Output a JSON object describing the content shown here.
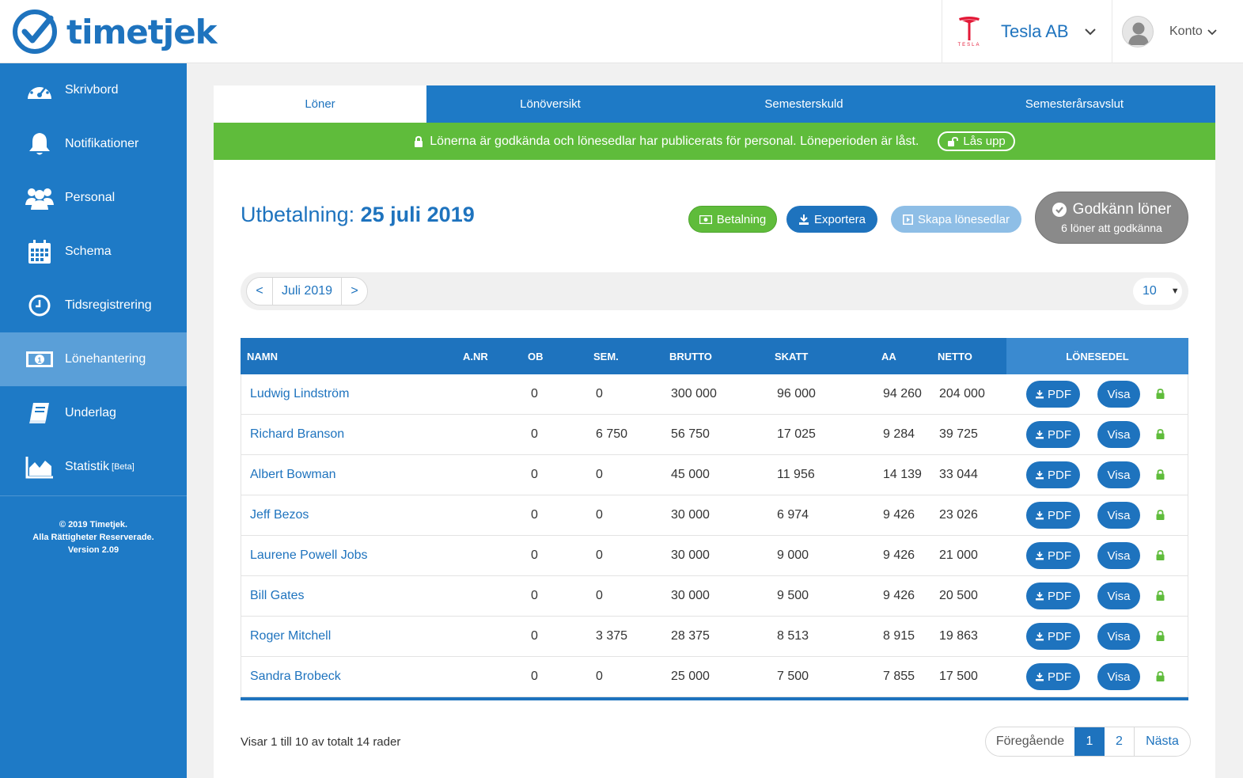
{
  "header": {
    "logo_text": "timetjek",
    "company_logo_label": "TESLA",
    "company_name": "Tesla AB",
    "account_label": "Konto"
  },
  "sidebar": {
    "items": [
      {
        "label": "Skrivbord",
        "icon": "dashboard-icon"
      },
      {
        "label": "Notifikationer",
        "icon": "bell-icon"
      },
      {
        "label": "Personal",
        "icon": "people-icon"
      },
      {
        "label": "Schema",
        "icon": "calendar-icon"
      },
      {
        "label": "Tidsregistrering",
        "icon": "clock-icon"
      },
      {
        "label": "Lönehantering",
        "icon": "money-icon",
        "active": true
      },
      {
        "label": "Underlag",
        "icon": "book-icon"
      },
      {
        "label": "Statistik",
        "badge": "[Beta]",
        "icon": "chart-icon"
      }
    ],
    "footer_line1": "© 2019 Timetjek.",
    "footer_line2": "Alla Rättigheter Reserverade.",
    "footer_line3": "Version 2.09"
  },
  "tabs": [
    "Löner",
    "Lönöversikt",
    "Semesterskuld",
    "Semesterårsavslut"
  ],
  "banner": {
    "text": "Lönerna är godkända och lönesedlar har publicerats för personal. Löneperioden är låst.",
    "unlock_label": "Lås upp"
  },
  "title": {
    "prefix": "Utbetalning:",
    "date": "25 juli 2019"
  },
  "actions": {
    "payment": "Betalning",
    "export": "Exportera",
    "create_payslips": "Skapa lönesedlar",
    "approve": "Godkänn löner",
    "approve_sub": "6 löner att godkänna"
  },
  "filter": {
    "prev": "<",
    "month": "Juli 2019",
    "next": ">",
    "per_page": "10"
  },
  "table": {
    "columns": [
      "NAMN",
      "A.NR",
      "OB",
      "SEM.",
      "BRUTTO",
      "SKATT",
      "AA",
      "NETTO",
      "LÖNESEDEL"
    ],
    "pdf_label": "PDF",
    "view_label": "Visa",
    "rows": [
      {
        "name": "Ludwig Lindström",
        "anr": "",
        "ob": "0",
        "sem": "0",
        "brutto": "300 000",
        "skatt": "96 000",
        "aa": "94 260",
        "netto": "204 000"
      },
      {
        "name": "Richard Branson",
        "anr": "",
        "ob": "0",
        "sem": "6 750",
        "brutto": "56 750",
        "skatt": "17 025",
        "aa": "9 284",
        "netto": "39 725"
      },
      {
        "name": "Albert Bowman",
        "anr": "",
        "ob": "0",
        "sem": "0",
        "brutto": "45 000",
        "skatt": "11 956",
        "aa": "14 139",
        "netto": "33 044"
      },
      {
        "name": "Jeff Bezos",
        "anr": "",
        "ob": "0",
        "sem": "0",
        "brutto": "30 000",
        "skatt": "6 974",
        "aa": "9 426",
        "netto": "23 026"
      },
      {
        "name": "Laurene Powell Jobs",
        "anr": "",
        "ob": "0",
        "sem": "0",
        "brutto": "30 000",
        "skatt": "9 000",
        "aa": "9 426",
        "netto": "21 000"
      },
      {
        "name": "Bill Gates",
        "anr": "",
        "ob": "0",
        "sem": "0",
        "brutto": "30 000",
        "skatt": "9 500",
        "aa": "9 426",
        "netto": "20 500"
      },
      {
        "name": "Roger Mitchell",
        "anr": "",
        "ob": "0",
        "sem": "3 375",
        "brutto": "28 375",
        "skatt": "8 513",
        "aa": "8 915",
        "netto": "19 863"
      },
      {
        "name": "Sandra Brobeck",
        "anr": "",
        "ob": "0",
        "sem": "0",
        "brutto": "25 000",
        "skatt": "7 500",
        "aa": "7 855",
        "netto": "17 500"
      }
    ]
  },
  "footer": {
    "summary": "Visar 1 till 10 av totalt 14 rader",
    "prev": "Föregående",
    "page1": "1",
    "page2": "2",
    "next": "Nästa"
  },
  "colors": {
    "primary": "#1e73be",
    "sidebar": "#1e7ac6",
    "success": "#5fbc3b",
    "muted": "#8a8a8a",
    "tesla_red": "#e31937"
  }
}
